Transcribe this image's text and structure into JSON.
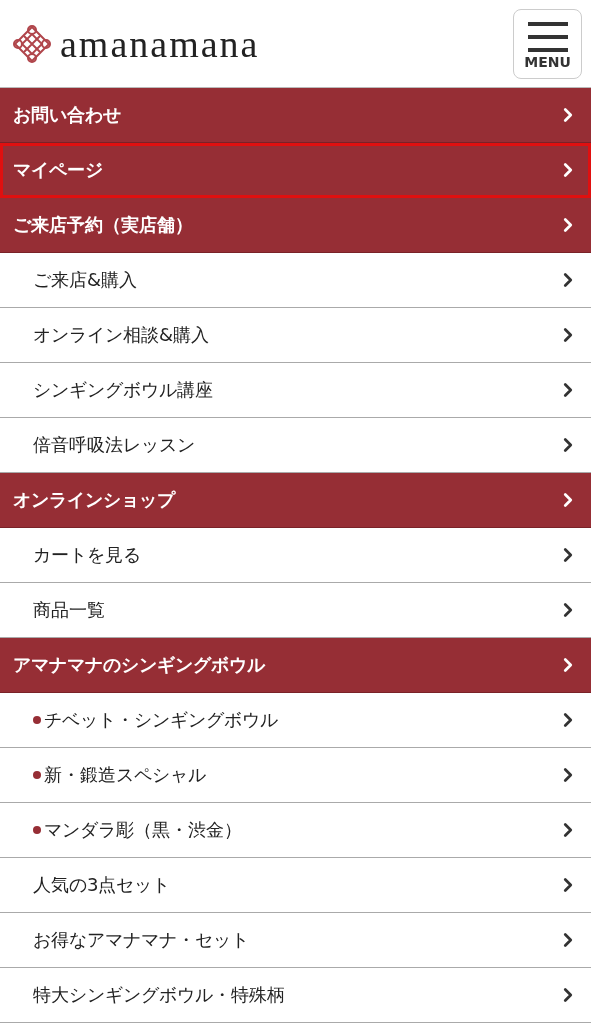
{
  "header": {
    "logo_text": "amanamana",
    "menu_button": {
      "label": "MENU"
    }
  },
  "menu_items": [
    {
      "kind": "section",
      "label": "お問い合わせ",
      "bullet": false,
      "highlighted": false
    },
    {
      "kind": "section",
      "label": "マイページ",
      "bullet": false,
      "highlighted": true
    },
    {
      "kind": "section",
      "label": "ご来店予約（実店舗）",
      "bullet": false,
      "highlighted": false
    },
    {
      "kind": "link",
      "label": "ご来店&購入",
      "bullet": false,
      "highlighted": false
    },
    {
      "kind": "link",
      "label": "オンライン相談&購入",
      "bullet": false,
      "highlighted": false
    },
    {
      "kind": "link",
      "label": "シンギングボウル講座",
      "bullet": false,
      "highlighted": false
    },
    {
      "kind": "link",
      "label": "倍音呼吸法レッスン",
      "bullet": false,
      "highlighted": false
    },
    {
      "kind": "section",
      "label": "オンラインショップ",
      "bullet": false,
      "highlighted": false
    },
    {
      "kind": "link",
      "label": "カートを見る",
      "bullet": false,
      "highlighted": false
    },
    {
      "kind": "link",
      "label": "商品一覧",
      "bullet": false,
      "highlighted": false
    },
    {
      "kind": "section",
      "label": "アマナマナのシンギングボウル",
      "bullet": false,
      "highlighted": false
    },
    {
      "kind": "link",
      "label": "チベット・シンギングボウル",
      "bullet": true,
      "highlighted": false
    },
    {
      "kind": "link",
      "label": "新・鍛造スペシャル",
      "bullet": true,
      "highlighted": false
    },
    {
      "kind": "link",
      "label": "マンダラ彫（黒・渋金）",
      "bullet": true,
      "highlighted": false
    },
    {
      "kind": "link",
      "label": "人気の3点セット",
      "bullet": false,
      "highlighted": false
    },
    {
      "kind": "link",
      "label": "お得なアマナマナ・セット",
      "bullet": false,
      "highlighted": false
    },
    {
      "kind": "link",
      "label": "特大シンギングボウル・特殊柄",
      "bullet": false,
      "highlighted": false
    }
  ]
}
